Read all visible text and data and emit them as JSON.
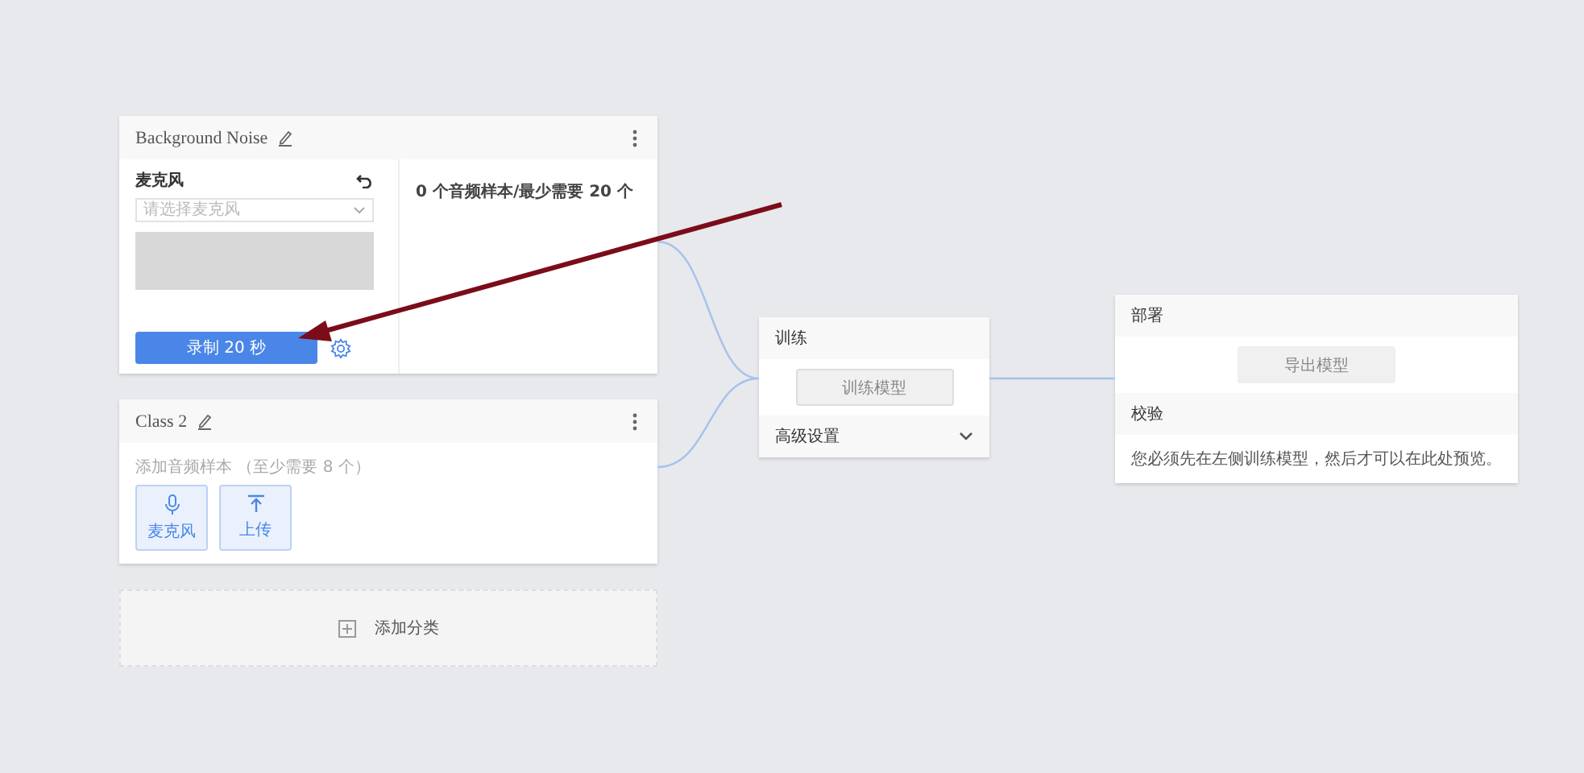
{
  "classes": [
    {
      "kind": "recording",
      "title": "Background Noise",
      "mic_label": "麦克风",
      "mic_select": {
        "placeholder": "请选择麦克风"
      },
      "record_button": "录制 20 秒",
      "sample_count": "0 个音频样本/最少需要 20 个"
    },
    {
      "kind": "empty",
      "title": "Class 2",
      "hint": "添加音频样本 （至少需要 8 个）",
      "sources": [
        {
          "kind": "mic",
          "label": "麦克风"
        },
        {
          "kind": "upload",
          "label": "上传"
        }
      ]
    }
  ],
  "add_class": "添加分类",
  "training": {
    "title": "训练",
    "button": "训练模型",
    "advanced": "高级设置",
    "expanded": false
  },
  "deploy": {
    "title": "部署",
    "export_button": "导出模型",
    "preview_title": "校验",
    "preview_text": "您必须先在左侧训练模型，然后才可以在此处预览。"
  }
}
